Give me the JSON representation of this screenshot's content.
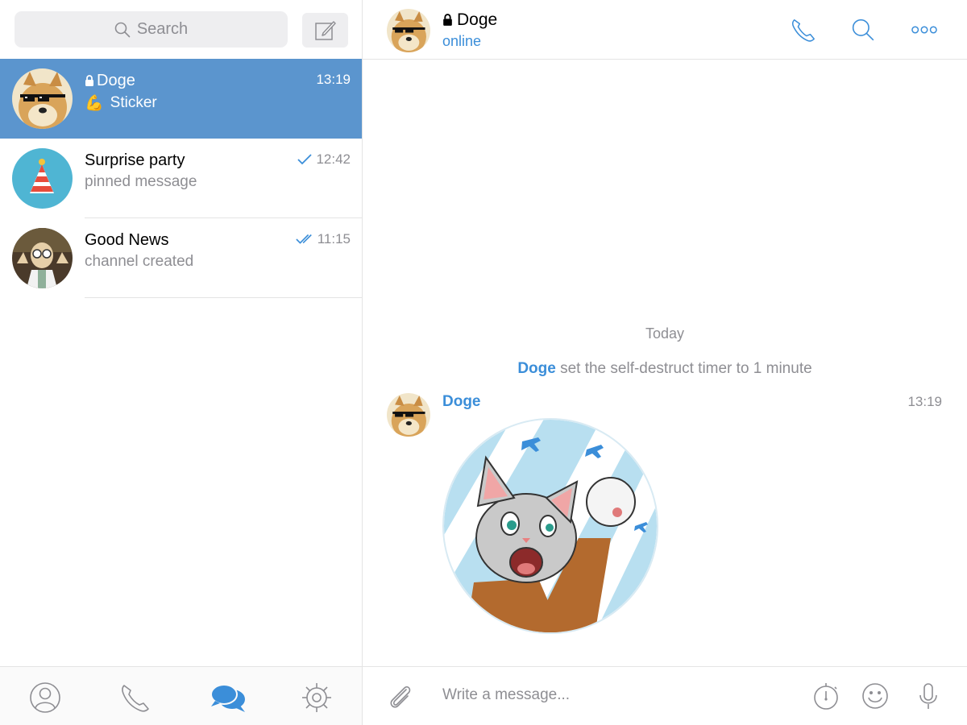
{
  "search": {
    "placeholder": "Search"
  },
  "chats": [
    {
      "name": "Doge",
      "secret": true,
      "preview_emoji": "💪",
      "preview": "Sticker",
      "time": "13:19",
      "active": true,
      "status": "none"
    },
    {
      "name": "Surprise party",
      "secret": false,
      "preview": "pinned message",
      "time": "12:42",
      "active": false,
      "status": "sent"
    },
    {
      "name": "Good News",
      "secret": false,
      "preview": "channel created",
      "time": "11:15",
      "active": false,
      "status": "read"
    }
  ],
  "tabs": [
    {
      "name": "contacts",
      "icon": "person-icon"
    },
    {
      "name": "calls",
      "icon": "phone-icon"
    },
    {
      "name": "chats",
      "icon": "chat-bubbles-icon",
      "active": true
    },
    {
      "name": "settings",
      "icon": "gear-icon"
    }
  ],
  "header": {
    "title": "Doge",
    "status": "online"
  },
  "conversation": {
    "date_label": "Today",
    "service": {
      "actor": "Doge",
      "text": " set the self-destruct timer to 1 minute"
    },
    "message": {
      "author": "Doge",
      "time": "13:19",
      "type": "sticker",
      "sticker": "cat-pilot-fist-sticker"
    }
  },
  "composer": {
    "placeholder": "Write a message..."
  },
  "colors": {
    "accent": "#3b8ed9",
    "active_row": "#5b95ce",
    "muted": "#8e8e93"
  }
}
